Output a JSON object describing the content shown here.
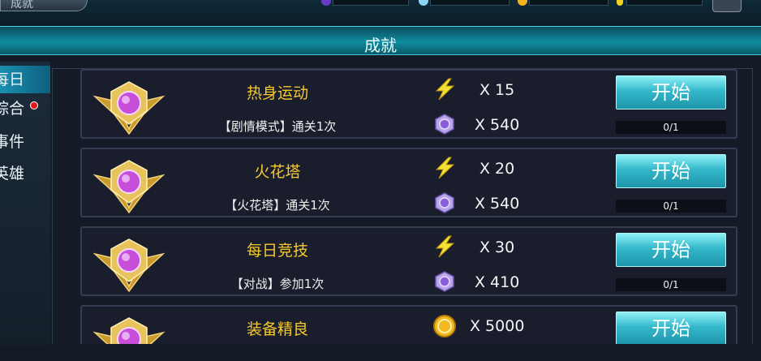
{
  "header": {
    "top_tab_label": "成就",
    "title": "成就"
  },
  "colors": {
    "banner": "#0e8da0",
    "task_name": "#f6c92c",
    "button": "#34b8ca",
    "notice_dot": "#e01818"
  },
  "sidebar": {
    "items": [
      {
        "label": "每日",
        "active": true,
        "notice": false
      },
      {
        "label": "综合",
        "active": false,
        "notice": true
      },
      {
        "label": "事件",
        "active": false,
        "notice": false
      },
      {
        "label": "英雄",
        "active": false,
        "notice": false
      }
    ]
  },
  "tasks": [
    {
      "name": "热身运动",
      "description": "【剧情模式】通关1次",
      "rewards": [
        {
          "icon": "lightning-icon",
          "amount": "X 15"
        },
        {
          "icon": "purple-gem-icon",
          "amount": "X 540"
        }
      ],
      "button_label": "开始",
      "progress": "0/1"
    },
    {
      "name": "火花塔",
      "description": "【火花塔】通关1次",
      "rewards": [
        {
          "icon": "lightning-icon",
          "amount": "X 20"
        },
        {
          "icon": "purple-gem-icon",
          "amount": "X 540"
        }
      ],
      "button_label": "开始",
      "progress": "0/1"
    },
    {
      "name": "每日竞技",
      "description": "【对战】参加1次",
      "rewards": [
        {
          "icon": "lightning-icon",
          "amount": "X 30"
        },
        {
          "icon": "purple-gem-icon",
          "amount": "X 410"
        }
      ],
      "button_label": "开始",
      "progress": "0/1"
    },
    {
      "name": "装备精良",
      "description": "",
      "rewards": [
        {
          "icon": "gold-coin-icon",
          "amount": "X 5000"
        }
      ],
      "button_label": "开始",
      "progress": ""
    }
  ]
}
